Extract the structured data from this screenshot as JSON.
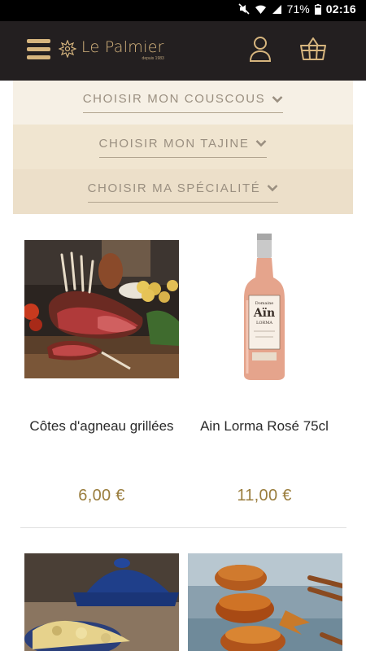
{
  "status_bar": {
    "battery": "71%",
    "time": "02:16",
    "icons": [
      "mute-icon",
      "wifi-icon",
      "signal-icon",
      "battery-icon"
    ]
  },
  "header": {
    "brand_name": "Le Palmier",
    "brand_sub": "depuis 1983",
    "icons": [
      "hamburger-menu-icon",
      "user-icon",
      "basket-icon"
    ],
    "colors": {
      "background": "#231f20",
      "accent": "#d6b57e"
    }
  },
  "categories": [
    {
      "label": "CHOISIR MON COUSCOUS"
    },
    {
      "label": "CHOISIR MON TAJINE"
    },
    {
      "label": "CHOISIR MA SPÉCIALITÉ"
    }
  ],
  "products": [
    {
      "name": "Côtes d'agneau grillées",
      "price": "6,00 €",
      "image": "grilled-lamb-rack"
    },
    {
      "name": "Ain Lorma Rosé 75cl",
      "price": "11,00 €",
      "image": "rose-wine-bottle"
    },
    {
      "name": "",
      "price": "",
      "image": "tajine-dish"
    },
    {
      "name": "",
      "price": "",
      "image": "caramelized-dessert"
    }
  ],
  "wine_label": {
    "line1": "Domaine",
    "line2": "Aïn",
    "line3": "LORMA"
  }
}
